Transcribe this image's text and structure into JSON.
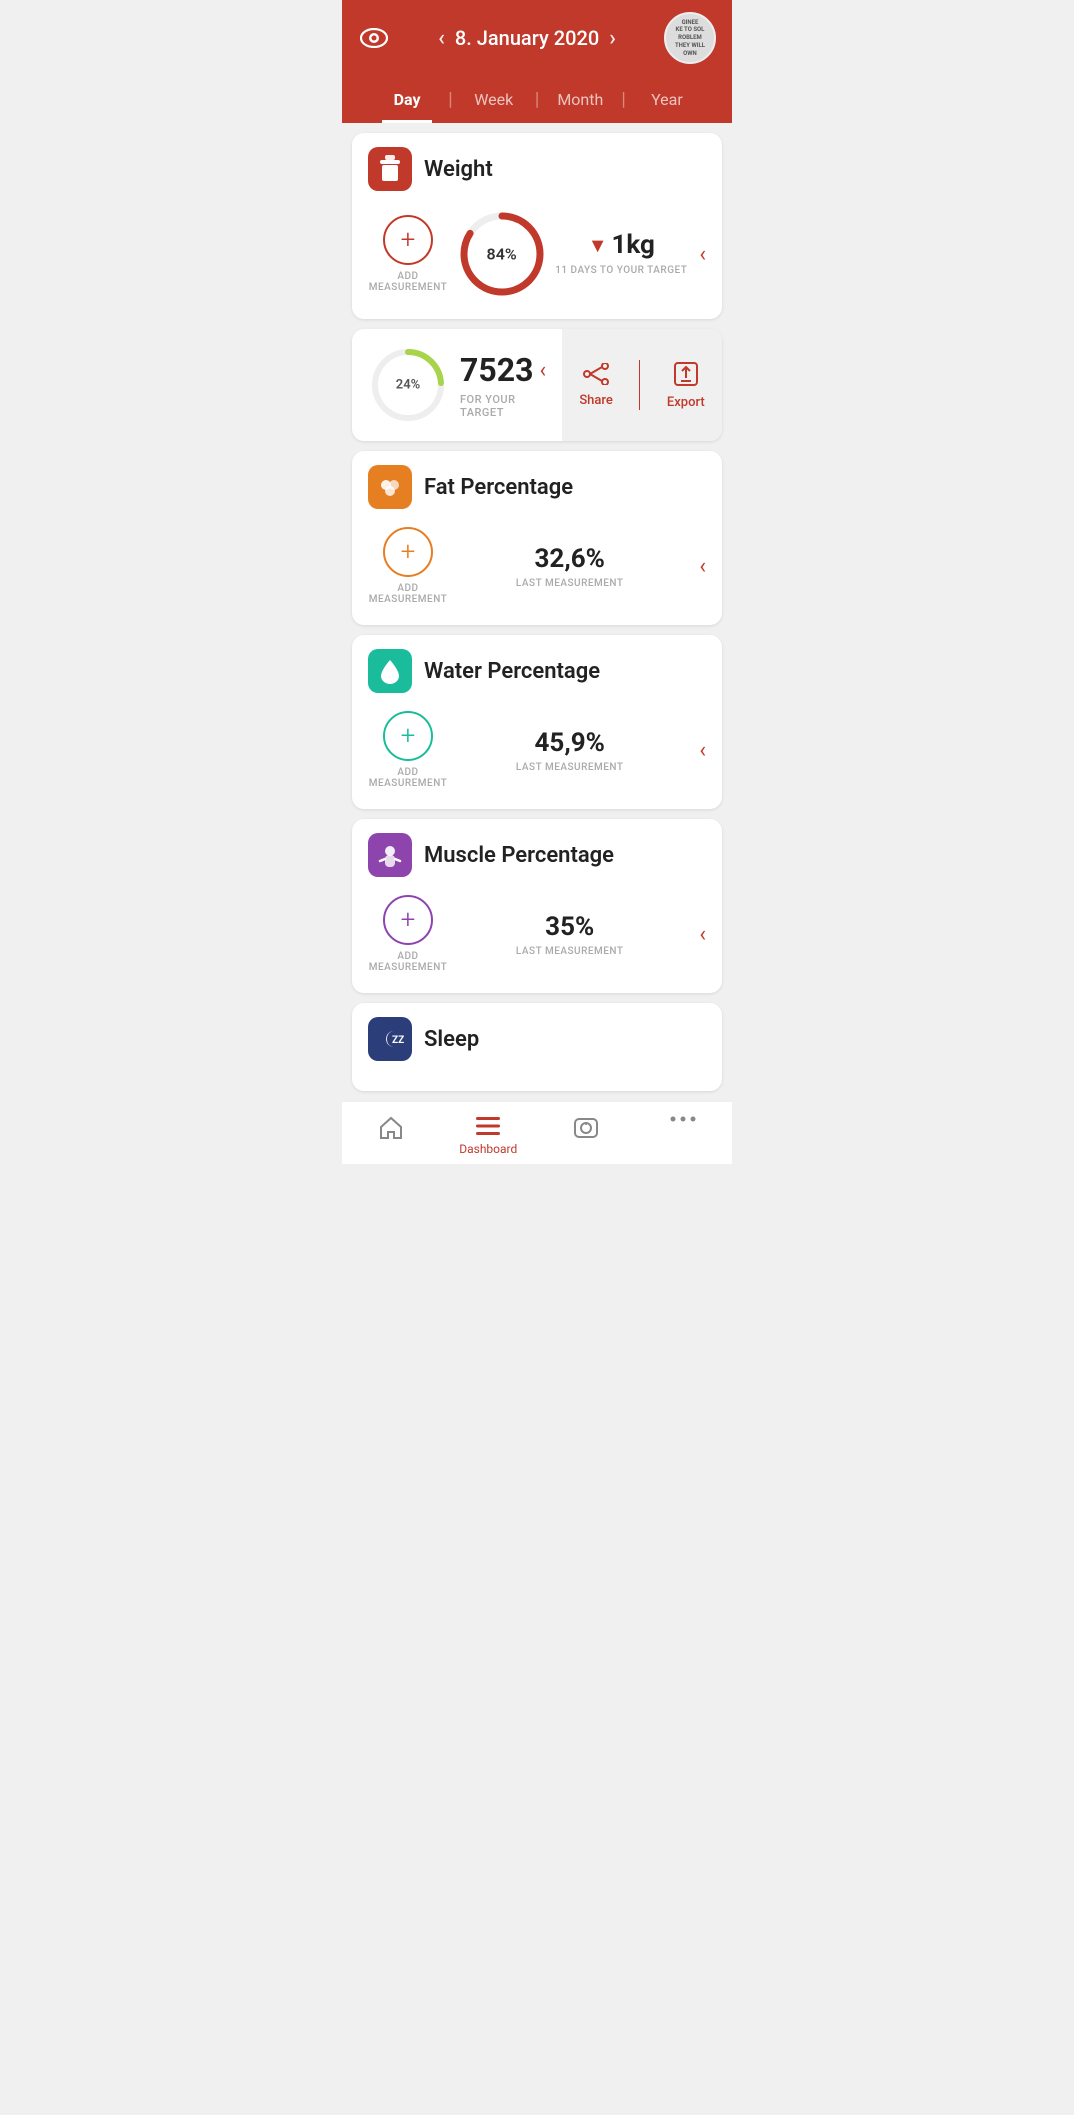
{
  "header": {
    "date": "8. January 2020",
    "prev_arrow": "‹",
    "next_arrow": "›",
    "logo_text": "GINEE\nKE TO SOL\nROBLEM\nTHEY WILL\nOWN"
  },
  "tabs": [
    {
      "id": "day",
      "label": "Day",
      "active": true
    },
    {
      "id": "week",
      "label": "Week",
      "active": false
    },
    {
      "id": "month",
      "label": "Month",
      "active": false
    },
    {
      "id": "year",
      "label": "Year",
      "active": false
    }
  ],
  "weight_card": {
    "title": "Weight",
    "add_label": "ADD\nMEASUREMENT",
    "progress_pct": 84,
    "progress_label": "84%",
    "target_value": "▼1kg",
    "target_down": "▼",
    "target_kg": "1kg",
    "target_sub": "11 DAYS TO YOUR\nTARGET"
  },
  "steps_card": {
    "ring_pct": 24,
    "ring_label": "24%",
    "steps_value": "7523",
    "steps_sub": "FOR YOUR TARGET",
    "share_label": "Share",
    "export_label": "Export"
  },
  "fat_card": {
    "title": "Fat Percentage",
    "add_label": "ADD\nMEASUREMENT",
    "value": "32,6%",
    "value_sub": "LAST\nMEASUREMENT"
  },
  "water_card": {
    "title": "Water Percentage",
    "add_label": "ADD\nMEASUREMENT",
    "value": "45,9%",
    "value_sub": "LAST\nMEASUREMENT"
  },
  "muscle_card": {
    "title": "Muscle Percentage",
    "add_label": "ADD\nMEASUREMENT",
    "value": "35%",
    "value_sub": "LAST\nMEASUREMENT"
  },
  "sleep_card": {
    "title": "Sleep"
  },
  "bottom_nav": [
    {
      "id": "home",
      "icon": "🏠",
      "label": ""
    },
    {
      "id": "dashboard",
      "icon": "☰",
      "label": "Dashboard",
      "active": true
    },
    {
      "id": "scale",
      "icon": "⊡",
      "label": ""
    },
    {
      "id": "more",
      "icon": "•••",
      "label": ""
    }
  ]
}
